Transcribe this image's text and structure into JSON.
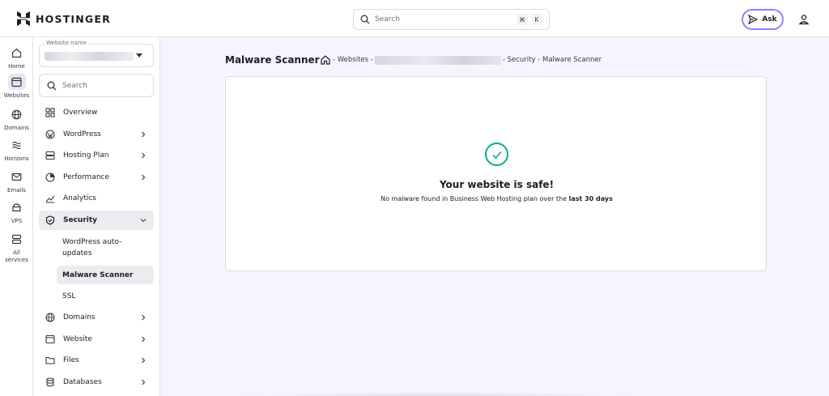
{
  "brand": {
    "name": "HOSTINGER"
  },
  "topbar": {
    "search_placeholder": "Search",
    "shortcut_keys": [
      "⌘",
      "K"
    ],
    "ask_label": "Ask"
  },
  "rail": [
    {
      "label": "Home",
      "icon": "home-icon"
    },
    {
      "label": "Websites",
      "icon": "websites-icon"
    },
    {
      "label": "Domains",
      "icon": "globe-icon"
    },
    {
      "label": "Horizons",
      "icon": "horizons-icon"
    },
    {
      "label": "Emails",
      "icon": "mail-icon"
    },
    {
      "label": "VPS",
      "icon": "vps-icon"
    },
    {
      "label": "All\nservices",
      "icon": "services-icon"
    }
  ],
  "sidebar": {
    "website_label": "Website name",
    "search_placeholder": "Search",
    "items": [
      {
        "label": "Overview",
        "icon": "grid-icon",
        "chevron": false
      },
      {
        "label": "WordPress",
        "icon": "wordpress-icon",
        "chevron": true
      },
      {
        "label": "Hosting Plan",
        "icon": "server-icon",
        "chevron": true
      },
      {
        "label": "Performance",
        "icon": "gauge-icon",
        "chevron": true
      },
      {
        "label": "Analytics",
        "icon": "chart-icon",
        "chevron": false
      },
      {
        "label": "Security",
        "icon": "shield-icon",
        "chevron": true,
        "open": true
      },
      {
        "label": "Domains",
        "icon": "globe-icon",
        "chevron": true
      },
      {
        "label": "Website",
        "icon": "browser-icon",
        "chevron": true
      },
      {
        "label": "Files",
        "icon": "folder-icon",
        "chevron": true
      },
      {
        "label": "Databases",
        "icon": "database-icon",
        "chevron": true
      }
    ],
    "security_sub": [
      {
        "label": "WordPress auto-\nupdates"
      },
      {
        "label": "Malware Scanner",
        "active": true
      },
      {
        "label": "SSL"
      }
    ]
  },
  "main": {
    "title": "Malware Scanner",
    "breadcrumb_websites": "- Websites -",
    "breadcrumb_tail": "- Security - Malware Scanner",
    "safe_title": "Your website is safe!",
    "safe_desc_prefix": "No malware found in Business Web Hosting plan over the ",
    "safe_desc_bold": "last 30 days"
  },
  "colors": {
    "success": "#00b090",
    "accent": "#673de6"
  }
}
